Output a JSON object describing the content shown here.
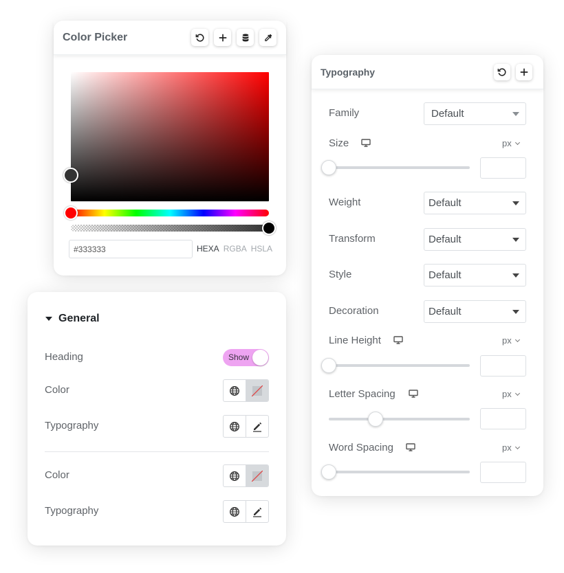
{
  "color_picker": {
    "title": "Color Picker",
    "toolbar": [
      "reset-icon",
      "plus-icon",
      "database-icon",
      "eyedropper-icon"
    ],
    "current_color": "#333333",
    "hex_value": "#333333",
    "hue_color": "#ff0000",
    "formats": [
      "HEXA",
      "RGBA",
      "HSLA"
    ],
    "active_format": "HEXA"
  },
  "typography": {
    "title": "Typography",
    "toolbar": [
      "reset-icon",
      "plus-icon"
    ],
    "family": {
      "label": "Family",
      "value": "Default"
    },
    "size": {
      "label": "Size",
      "unit": "px",
      "value": "",
      "slider": 0
    },
    "weight": {
      "label": "Weight",
      "value": "Default"
    },
    "transform": {
      "label": "Transform",
      "value": "Default"
    },
    "style": {
      "label": "Style",
      "value": "Default"
    },
    "decoration": {
      "label": "Decoration",
      "value": "Default"
    },
    "line_height": {
      "label": "Line Height",
      "unit": "px",
      "value": "",
      "slider": 0
    },
    "letter_spacing": {
      "label": "Letter Spacing",
      "unit": "px",
      "value": "",
      "slider": 0.33
    },
    "word_spacing": {
      "label": "Word Spacing",
      "unit": "px",
      "value": "",
      "slider": 0
    }
  },
  "general": {
    "title": "General",
    "heading": {
      "label": "Heading",
      "toggle_text": "Show",
      "toggle_on": true
    },
    "rows": [
      {
        "label": "Color"
      },
      {
        "label": "Typography"
      },
      {
        "label": "Color"
      },
      {
        "label": "Typography"
      }
    ]
  },
  "colors": {
    "toggle_bg": "#eea4f1",
    "text": "#5f6368",
    "swatch_none": "#d7dadd"
  }
}
